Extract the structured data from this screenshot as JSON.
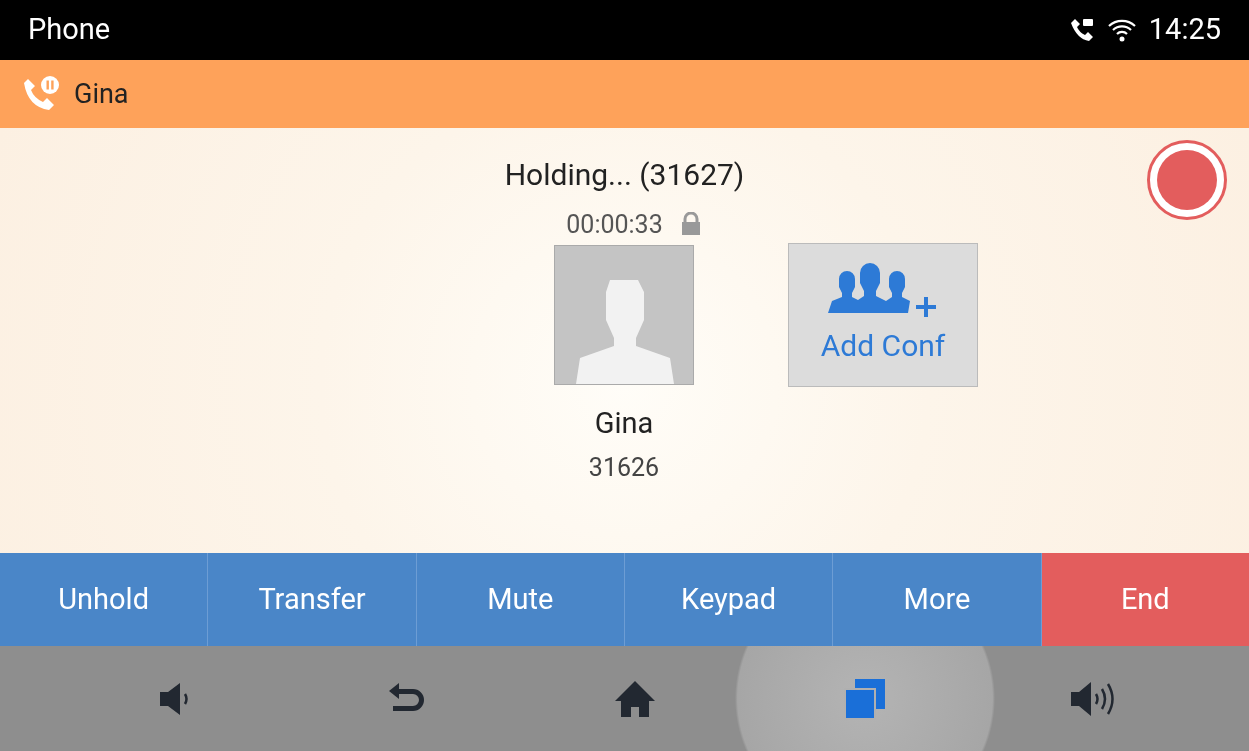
{
  "status_bar": {
    "title": "Phone",
    "time": "14:25"
  },
  "call_banner": {
    "name": "Gina"
  },
  "call": {
    "status": "Holding... (31627)",
    "duration": "00:00:33",
    "contact_name": "Gina",
    "contact_number": "31626",
    "add_conf_label": "Add Conf"
  },
  "actions": [
    {
      "label": "Unhold",
      "kind": "normal"
    },
    {
      "label": "Transfer",
      "kind": "normal"
    },
    {
      "label": "Mute",
      "kind": "normal"
    },
    {
      "label": "Keypad",
      "kind": "normal"
    },
    {
      "label": "More",
      "kind": "normal"
    },
    {
      "label": "End",
      "kind": "end"
    }
  ],
  "nav_bar": [
    {
      "kind": "volume-down",
      "selected": false
    },
    {
      "kind": "back",
      "selected": false
    },
    {
      "kind": "home",
      "selected": false
    },
    {
      "kind": "recents",
      "selected": true
    },
    {
      "kind": "volume-up",
      "selected": false
    }
  ]
}
